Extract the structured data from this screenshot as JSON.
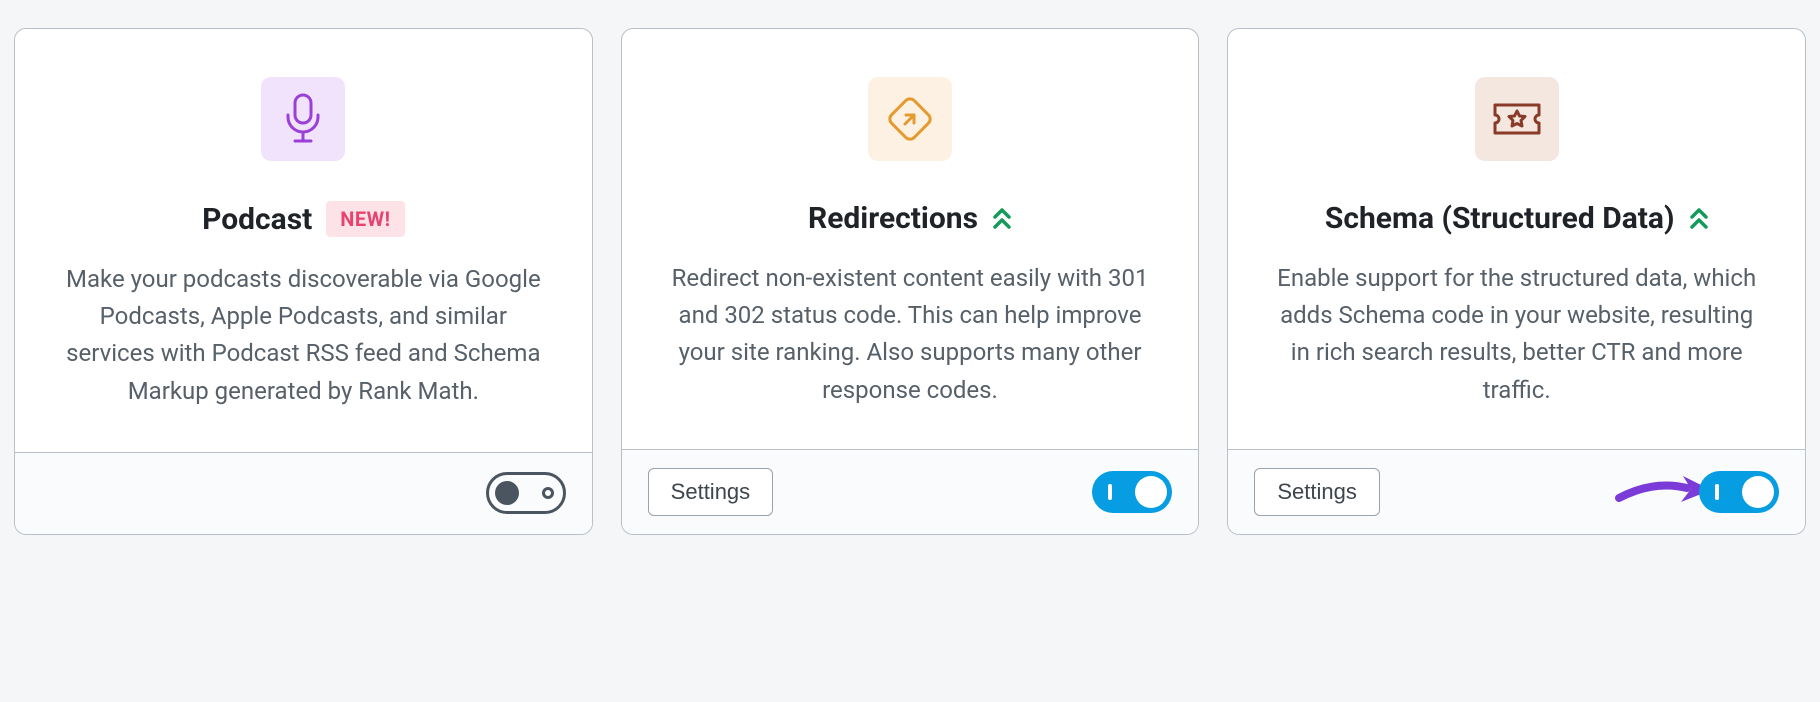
{
  "cards": [
    {
      "title": "Podcast",
      "badge": "NEW!",
      "description": "Make your podcasts discoverable via Google Podcasts, Apple Podcasts, and similar services with Podcast RSS feed and Schema Markup generated by Rank Math.",
      "showSettings": false,
      "settingsLabel": "",
      "toggleOn": false,
      "icon": "mic-icon",
      "iconColor": "purple",
      "showChevron": false,
      "showArrow": false
    },
    {
      "title": "Redirections",
      "badge": "",
      "description": "Redirect non-existent content easily with 301 and 302 status code. This can help improve your site ranking. Also supports many other response codes.",
      "showSettings": true,
      "settingsLabel": "Settings",
      "toggleOn": true,
      "icon": "redirect-icon",
      "iconColor": "orange",
      "showChevron": true,
      "showArrow": false
    },
    {
      "title": "Schema (Structured Data)",
      "badge": "",
      "description": "Enable support for the structured data, which adds Schema code in your website, resulting in rich search results, better CTR and more traffic.",
      "showSettings": true,
      "settingsLabel": "Settings",
      "toggleOn": true,
      "icon": "ticket-icon",
      "iconColor": "brown",
      "showChevron": true,
      "showArrow": true
    }
  ]
}
